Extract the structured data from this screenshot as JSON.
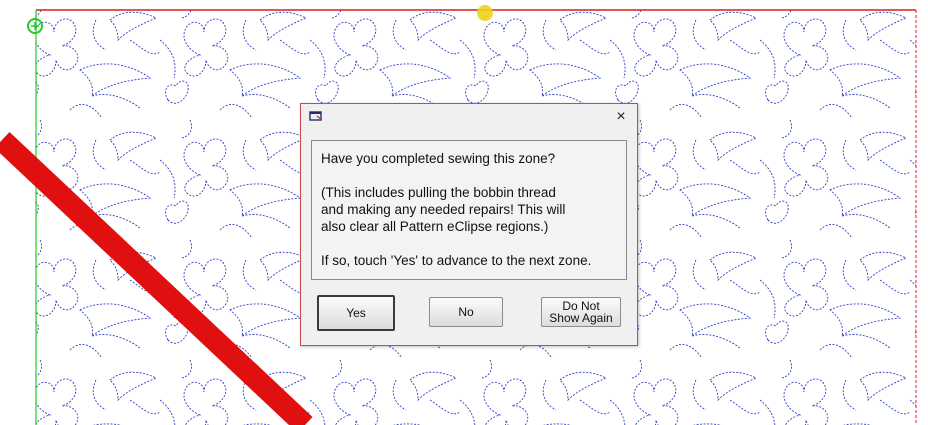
{
  "dialog": {
    "close_glyph": "×",
    "message_lines": [
      "Have you completed sewing this zone?",
      "",
      "(This includes pulling the bobbin thread",
      "and making any needed repairs! This will",
      "also clear all Pattern eClipse regions.)",
      "",
      "If so, touch 'Yes' to advance to the next zone."
    ],
    "buttons": {
      "yes": "Yes",
      "no": "No",
      "do_not_show_line1": "Do Not",
      "do_not_show_line2": "Show Again"
    }
  },
  "colors": {
    "stitch_line": "#2f3ec4",
    "boundary_red": "#d42020",
    "boundary_green": "#22cc22",
    "start_marker": "#22cc22",
    "needle_marker": "#f2d21a",
    "dialog_border": "#c94a4a"
  },
  "icons": [
    "app-window-icon",
    "close-icon",
    "start-point-marker",
    "needle-position-marker"
  ]
}
